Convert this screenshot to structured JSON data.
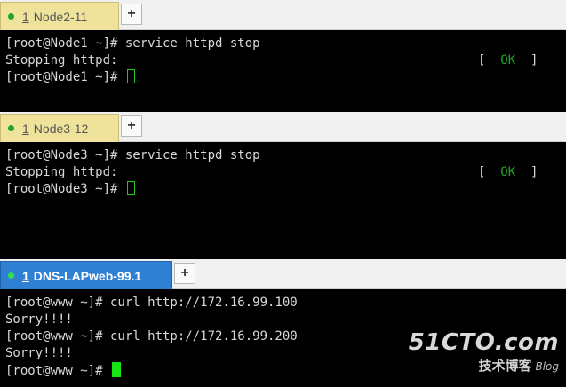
{
  "panes": [
    {
      "tab": {
        "number": "1",
        "title": "Node2-11"
      },
      "new_tab_label": "+",
      "lines": [
        {
          "text": "[root@Node1 ~]# service httpd stop"
        },
        {
          "text": "Stopping httpd:",
          "status_open": "[  ",
          "status_ok": "OK",
          "status_close": "  ]"
        },
        {
          "text": "[root@Node1 ~]# "
        }
      ]
    },
    {
      "tab": {
        "number": "1",
        "title": "Node3-12"
      },
      "new_tab_label": "+",
      "lines": [
        {
          "text": "[root@Node3 ~]# service httpd stop"
        },
        {
          "text": "Stopping httpd:",
          "status_open": "[  ",
          "status_ok": "OK",
          "status_close": "  ]"
        },
        {
          "text": "[root@Node3 ~]# "
        }
      ]
    },
    {
      "tab": {
        "number": "1",
        "title": "DNS-LAPweb-99.1"
      },
      "new_tab_label": "+",
      "lines": [
        {
          "text": "[root@www ~]# curl http://172.16.99.100"
        },
        {
          "text": "Sorry!!!!"
        },
        {
          "text": "[root@www ~]# curl http://172.16.99.200"
        },
        {
          "text": "Sorry!!!!"
        },
        {
          "text": "[root@www ~]# "
        }
      ]
    }
  ],
  "watermark": {
    "brand": "51CTO.com",
    "sub": "技术博客",
    "blog": "Blog"
  },
  "colors": {
    "tab_inactive": "#efe29a",
    "tab_active": "#2f7fd3",
    "ok_green": "#1fa81f",
    "cursor_green": "#16e616"
  }
}
